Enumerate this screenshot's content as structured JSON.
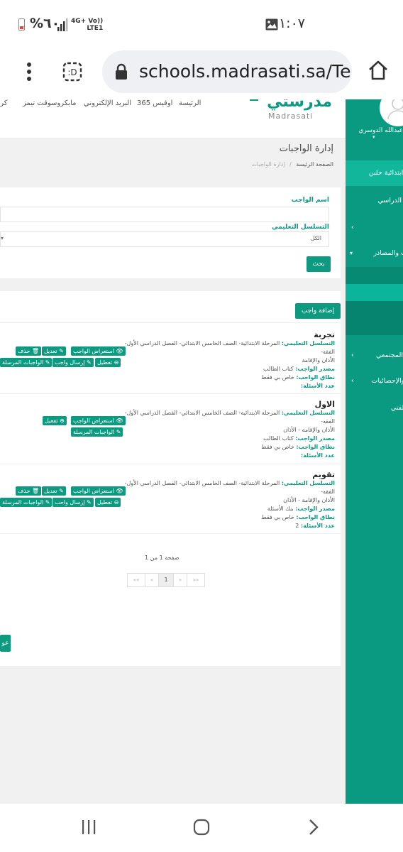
{
  "status_bar": {
    "time": "١:٠٧",
    "battery_percent": "%٦٠",
    "network_line1": "4G+ Vo))",
    "network_line2": "LTE1"
  },
  "browser": {
    "url": "schools.madrasati.sa/Tea"
  },
  "top_nav": {
    "links": [
      "الرئيسة",
      "أوفيس 365",
      "البريد الإلكتروني",
      "مايكروسوفت تيمز",
      "كروب"
    ],
    "logo_text": "مدرستي",
    "logo_sub": "Madrasati"
  },
  "sidebar": {
    "user_name": "عبدالله الدوسري",
    "items": [
      "– ابتدائية حلبن",
      "ل الدراسي",
      "",
      "ت والمصادر",
      "",
      "",
      "",
      "ل المجتمعي",
      "ر والإحصائيات",
      "الفني"
    ]
  },
  "header": {
    "title": "إدارة الواجبات",
    "breadcrumb_home": "الصفحة الرئيسة",
    "breadcrumb_sep": "/",
    "breadcrumb_current": "إدارة الواجبات"
  },
  "search": {
    "name_label": "اسم الواجب",
    "name_value": "",
    "hierarchy_label": "التسلسل التعليمي",
    "hierarchy_value": "الكل",
    "search_button": "بحث"
  },
  "list": {
    "add_button": "إضافة واجب",
    "labels": {
      "hierarchy": "التسلسل التعليمي:",
      "source": "مصدر الواجب:",
      "scope": "نطاق الواجب:",
      "questions": "عدد الأسئلة:"
    },
    "buttons": {
      "preview": "استعراض الواجب",
      "edit": "تعديل",
      "delete": "حذف",
      "disable": "تعطيل",
      "send": "إرسال واجب",
      "sent": "الواجبات المرسلة",
      "enable": "تفعيل"
    },
    "items": [
      {
        "title": "تجربة",
        "hierarchy": "المرحلة الابتدائية- الصف الخامس الابتدائي- الفصل الدراسي الأول- الفقه-",
        "hierarchy2": "الأذان والإقامة",
        "source": "كتاب الطالب",
        "scope": "خاص بي فقط",
        "questions": ""
      },
      {
        "title": "الاول",
        "hierarchy": "المرحلة الابتدائية- الصف الخامس الابتدائي- الفصل الدراسي الأول- الفقه-",
        "hierarchy2": "الأذان والإقامة - الأذان",
        "source": "كتاب الطالب",
        "scope": "خاص بي فقط",
        "questions": ""
      },
      {
        "title": "تقويم",
        "hierarchy": "المرحلة الابتدائية- الصف الخامس الابتدائي- الفصل الدراسي الأول- الفقه-",
        "hierarchy2": "الأذان والإقامة - الأذان",
        "source": "بنك الأسئلة",
        "scope": "خاص بي فقط",
        "questions": "2"
      }
    ]
  },
  "pagination": {
    "summary": "صفحة 1 من 1",
    "first": "««",
    "prev": "«",
    "current": "1",
    "next": "»",
    "last": "»»"
  },
  "footer_button": "عو",
  "colors": {
    "primary": "#0a9a82",
    "sidebar_active": "#07b49a",
    "sidebar_dark": "#057a66"
  }
}
